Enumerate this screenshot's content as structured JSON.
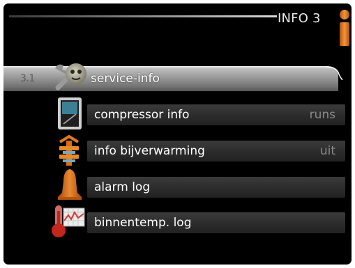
{
  "header": {
    "title": "INFO 3",
    "info_icon": "info-icon"
  },
  "menu": {
    "items": [
      {
        "index": "3.1",
        "label": "service-info",
        "value": "",
        "icon": "wrench-gear-icon",
        "selected": true
      },
      {
        "index": "",
        "label": "compressor info",
        "value": "runs",
        "icon": "compressor-icon",
        "selected": false
      },
      {
        "index": "",
        "label": "info bijverwarming",
        "value": "uit",
        "icon": "heater-icon",
        "selected": false
      },
      {
        "index": "",
        "label": "alarm log",
        "value": "",
        "icon": "alarm-bell-icon",
        "selected": false
      },
      {
        "index": "",
        "label": "binnentemp. log",
        "value": "",
        "icon": "thermometer-graph-icon",
        "selected": false
      }
    ]
  },
  "colors": {
    "accent": "#e07a1e",
    "background": "#000000",
    "text": "#ffffff",
    "value_text": "#8a8a8a"
  }
}
